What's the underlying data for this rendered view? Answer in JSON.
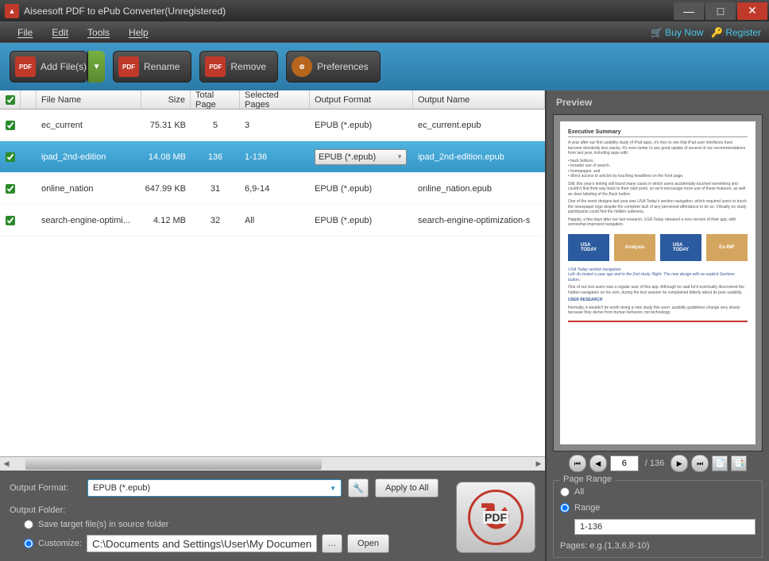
{
  "title": "Aiseesoft PDF to ePub Converter(Unregistered)",
  "menu": {
    "file": "File",
    "edit": "Edit",
    "tools": "Tools",
    "help": "Help"
  },
  "topLinks": {
    "buy": "Buy Now",
    "register": "Register"
  },
  "toolbar": {
    "addFiles": "Add File(s)",
    "rename": "Rename",
    "remove": "Remove",
    "preferences": "Preferences"
  },
  "table": {
    "headers": {
      "fileName": "File Name",
      "size": "Size",
      "totalPage": "Total Page",
      "selectedPages": "Selected Pages",
      "outputFormat": "Output Format",
      "outputName": "Output Name"
    },
    "rows": [
      {
        "checked": true,
        "name": "ec_current",
        "size": "75.31 KB",
        "pages": "5",
        "selected": "3",
        "format": "EPUB (*.epub)",
        "output": "ec_current.epub",
        "selectedRow": false
      },
      {
        "checked": true,
        "name": "ipad_2nd-edition",
        "size": "14.08 MB",
        "pages": "136",
        "selected": "1-136",
        "format": "EPUB (*.epub)",
        "output": "ipad_2nd-edition.epub",
        "selectedRow": true
      },
      {
        "checked": true,
        "name": "online_nation",
        "size": "647.99 KB",
        "pages": "31",
        "selected": "6,9-14",
        "format": "EPUB (*.epub)",
        "output": "online_nation.epub",
        "selectedRow": false
      },
      {
        "checked": true,
        "name": "search-engine-optimi...",
        "size": "4.12 MB",
        "pages": "32",
        "selected": "All",
        "format": "EPUB (*.epub)",
        "output": "search-engine-optimization-s",
        "selectedRow": false
      }
    ]
  },
  "output": {
    "formatLabel": "Output Format:",
    "formatValue": "EPUB (*.epub)",
    "applyAll": "Apply to All",
    "folderLabel": "Output Folder:",
    "saveInSource": "Save target file(s) in source folder",
    "customize": "Customize:",
    "customPath": "C:\\Documents and Settings\\User\\My Documents\\Aiseesoft Studio",
    "open": "Open",
    "pdfLabel": "PDF"
  },
  "preview": {
    "label": "Preview",
    "currentPage": "6",
    "totalPages": "/ 136",
    "docHeading": "Executive Summary"
  },
  "range": {
    "legend": "Page Range",
    "all": "All",
    "range": "Range",
    "value": "1-136",
    "hint": "Pages: e.g.(1,3,6,8-10)"
  }
}
